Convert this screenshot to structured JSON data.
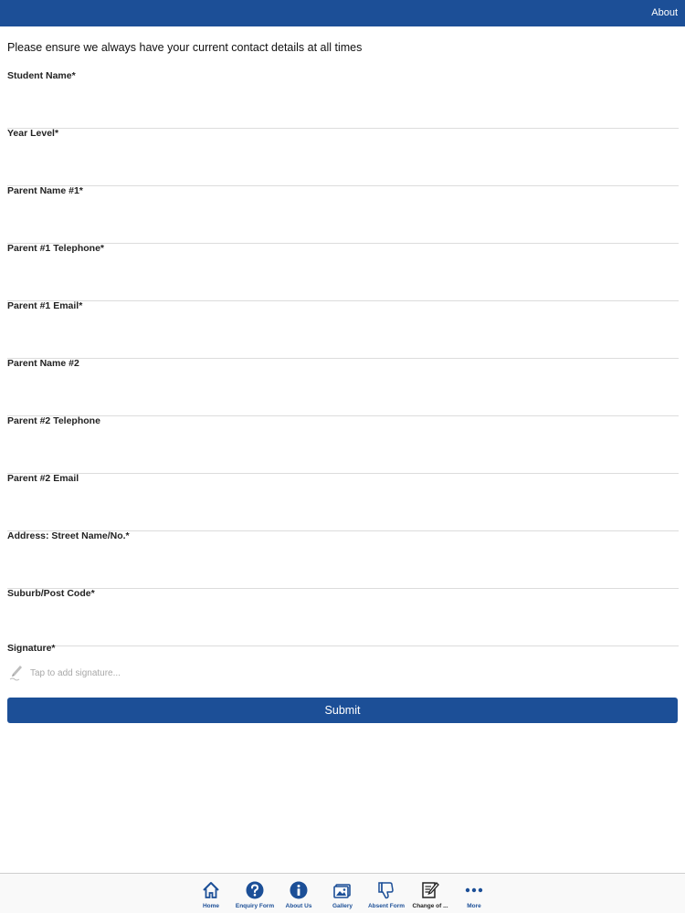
{
  "header": {
    "about_label": "About"
  },
  "form": {
    "intro": "Please ensure we always have your current contact details at all times",
    "fields": [
      {
        "label": "Student Name*",
        "value": ""
      },
      {
        "label": "Year Level*",
        "value": ""
      },
      {
        "label": "Parent Name #1*",
        "value": ""
      },
      {
        "label": "Parent #1 Telephone*",
        "value": ""
      },
      {
        "label": "Parent #1 Email*",
        "value": ""
      },
      {
        "label": "Parent Name #2",
        "value": ""
      },
      {
        "label": "Parent #2 Telephone",
        "value": ""
      },
      {
        "label": "Parent #2 Email",
        "value": ""
      },
      {
        "label": "Address: Street Name/No.*",
        "value": ""
      },
      {
        "label": "Suburb/Post Code*",
        "value": ""
      }
    ],
    "signature": {
      "label": "Signature*",
      "placeholder": "Tap to add signature..."
    },
    "submit_label": "Submit"
  },
  "tabbar": {
    "items": [
      {
        "label": "Home",
        "icon": "home-icon"
      },
      {
        "label": "Enquiry Form",
        "icon": "question-icon"
      },
      {
        "label": "About Us",
        "icon": "info-icon"
      },
      {
        "label": "Gallery",
        "icon": "gallery-icon"
      },
      {
        "label": "Absent Form",
        "icon": "thumbs-down-icon"
      },
      {
        "label": "Change of ...",
        "icon": "edit-document-icon"
      },
      {
        "label": "More",
        "icon": "more-icon"
      }
    ]
  },
  "colors": {
    "brand": "#1c4f97",
    "divider": "#dcdcdc"
  }
}
